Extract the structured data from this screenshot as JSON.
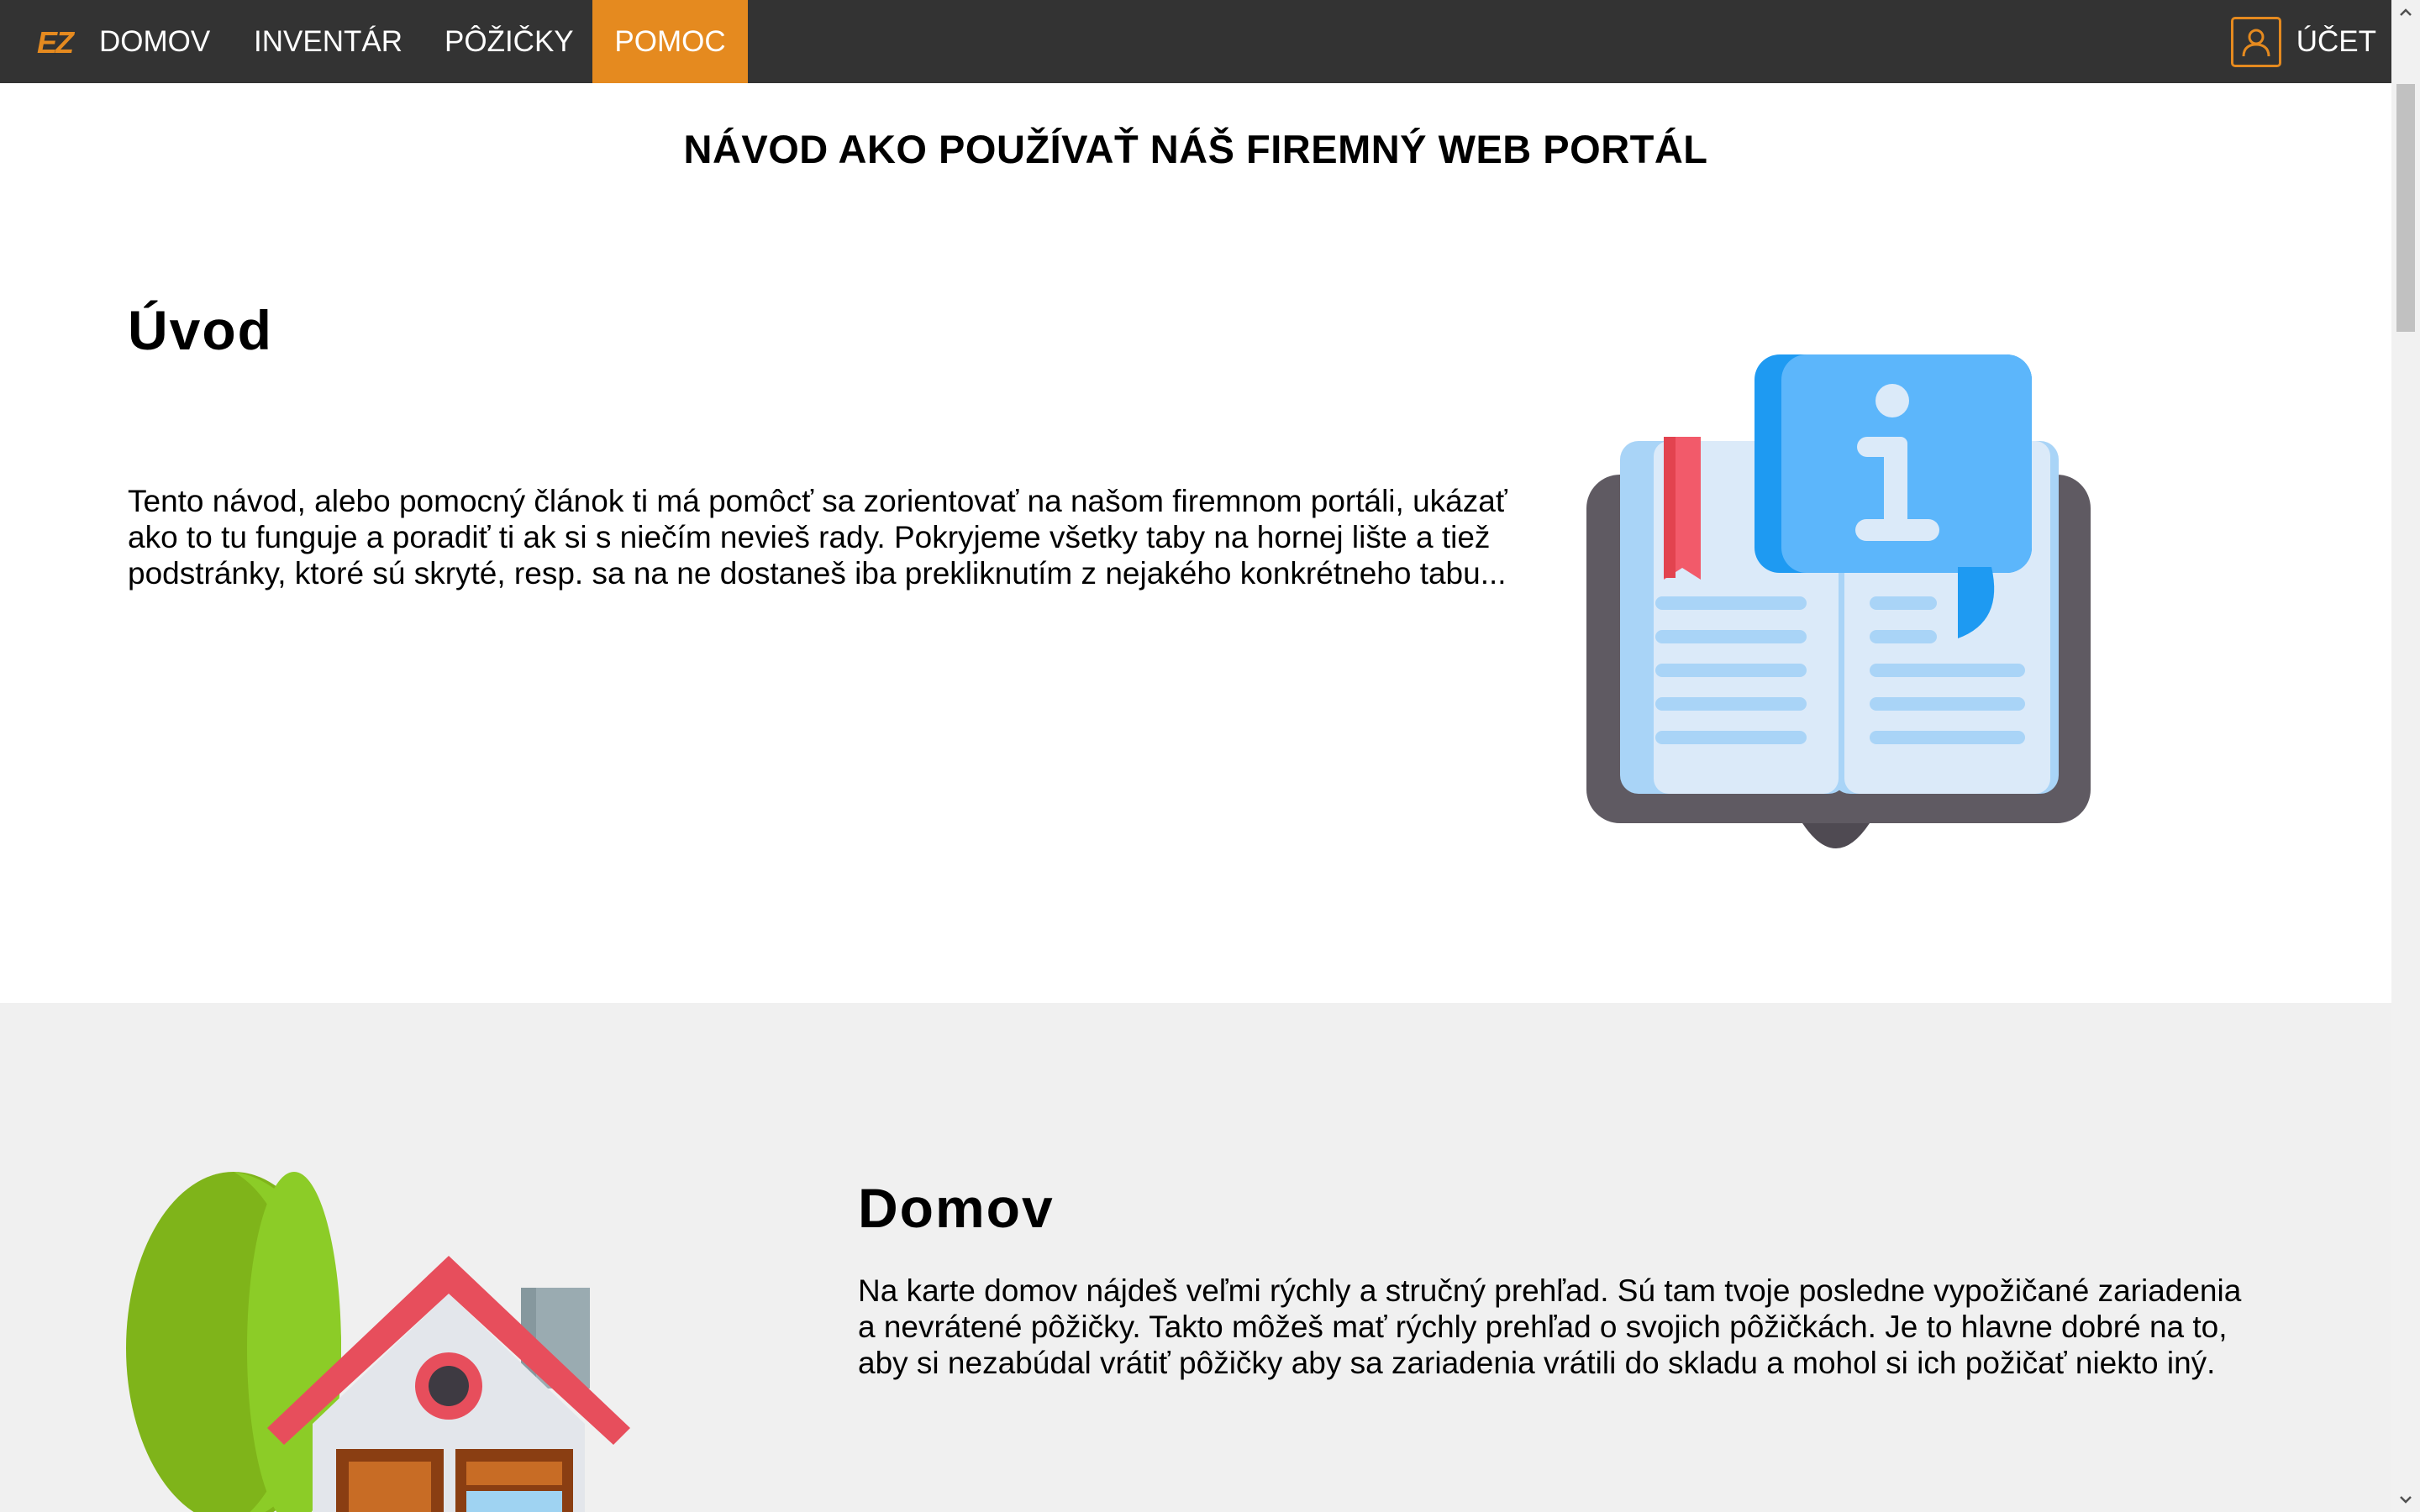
{
  "nav": {
    "brand": "EZ",
    "items": [
      "DOMOV",
      "INVENTÁR",
      "PÔŽIČKY",
      "POMOC"
    ],
    "active": "POMOC",
    "account": "ÚČET"
  },
  "page": {
    "title": "NÁVOD AKO POUŽÍVAŤ NÁŠ FIREMNÝ WEB PORTÁL"
  },
  "sections": {
    "intro": {
      "heading": "Úvod",
      "text": "Tento návod, alebo pomocný článok ti má pomôcť sa zorientovať na našom firemnom portáli, ukázať ako to tu funguje a poradiť ti ak si s niečím nevieš rady. Pokryjeme všetky taby na hornej lište a tiež podstránky, ktoré sú skryté, resp. sa na ne dostaneš iba prekliknutím z nejakého konkrétneho tabu...",
      "illustration": "book-info-icon"
    },
    "home": {
      "heading": "Domov",
      "text": "Na karte domov nájdeš veľmi rýchly a stručný prehľad. Sú tam tvoje posledne vypožičané zariadenia a nevrátené pôžičky. Takto môžeš mať rýchly prehľad o svojich pôžičkách. Je to hlavne dobré na to, aby si nezabúdal vrátiť pôžičky aby sa zariadenia vrátili do skladu a mohol si ich požičať niekto iný.",
      "illustration": "house-tree-icon"
    }
  },
  "colors": {
    "accent": "#e58a1f",
    "navbar": "#333333",
    "section_alt": "#f0f0f0"
  }
}
